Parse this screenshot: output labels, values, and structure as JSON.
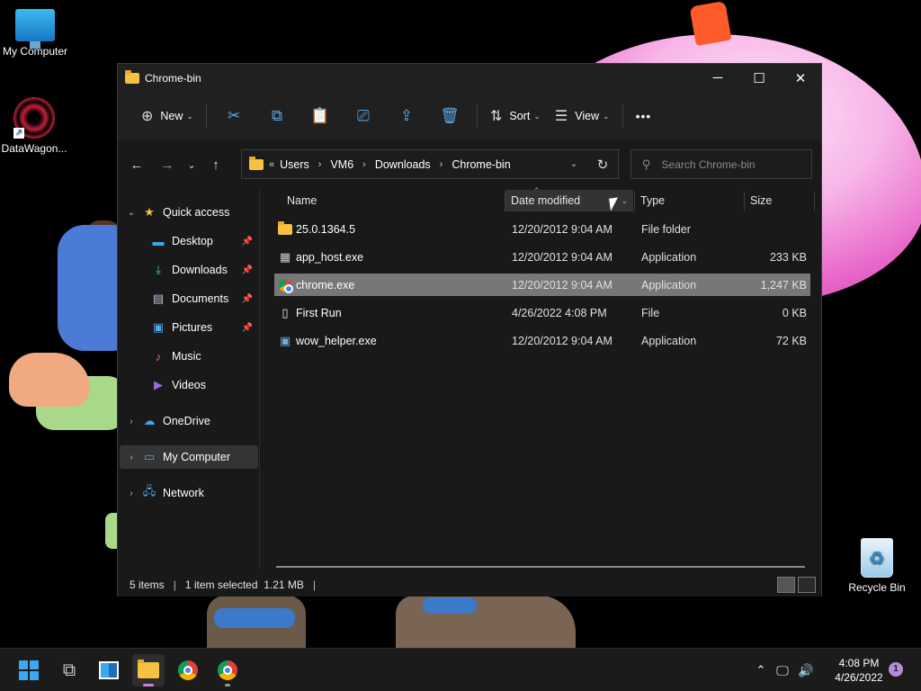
{
  "desktop": {
    "icons": {
      "my_computer": "My Computer",
      "datawagon": "DataWagon...",
      "recycle_bin": "Recycle Bin"
    }
  },
  "window": {
    "title": "Chrome-bin",
    "controls": {
      "minimize": "─",
      "maximize": "☐",
      "close": "✕"
    }
  },
  "toolbar": {
    "new_label": "New",
    "sort_label": "Sort",
    "view_label": "View",
    "more_label": "•••",
    "icons": [
      "cut-icon",
      "copy-icon",
      "paste-icon",
      "rename-icon",
      "share-icon",
      "delete-icon"
    ]
  },
  "address": {
    "overflow": "«",
    "crumbs": [
      "Users",
      "VM6",
      "Downloads",
      "Chrome-bin"
    ],
    "separator": "›"
  },
  "search": {
    "placeholder": "Search Chrome-bin"
  },
  "nav": {
    "quick_access": "Quick access",
    "items": [
      "Desktop",
      "Downloads",
      "Documents",
      "Pictures",
      "Music",
      "Videos"
    ],
    "onedrive": "OneDrive",
    "my_computer": "My Computer",
    "network": "Network"
  },
  "columns": {
    "name": "Name",
    "date": "Date modified",
    "type": "Type",
    "size": "Size"
  },
  "files": [
    {
      "name": "25.0.1364.5",
      "date": "12/20/2012 9:04 AM",
      "type": "File folder",
      "size": "",
      "icon": "folder-icon"
    },
    {
      "name": "app_host.exe",
      "date": "12/20/2012 9:04 AM",
      "type": "Application",
      "size": "233 KB",
      "icon": "app-icon"
    },
    {
      "name": "chrome.exe",
      "date": "12/20/2012 9:04 AM",
      "type": "Application",
      "size": "1,247 KB",
      "icon": "chrome-icon"
    },
    {
      "name": "First Run",
      "date": "4/26/2022 4:08 PM",
      "type": "File",
      "size": "0 KB",
      "icon": "file-icon"
    },
    {
      "name": "wow_helper.exe",
      "date": "12/20/2012 9:04 AM",
      "type": "Application",
      "size": "72 KB",
      "icon": "exe-icon"
    }
  ],
  "status": {
    "items": "5 items",
    "selected": "1 item selected  1.21 MB",
    "sep": "|"
  },
  "taskbar": {
    "time": "4:08 PM",
    "date": "4/26/2022",
    "notifications": "1"
  },
  "colors": {
    "accent": "#3ba8f0",
    "selected_row": "#777777",
    "folder": "#f5c141"
  }
}
